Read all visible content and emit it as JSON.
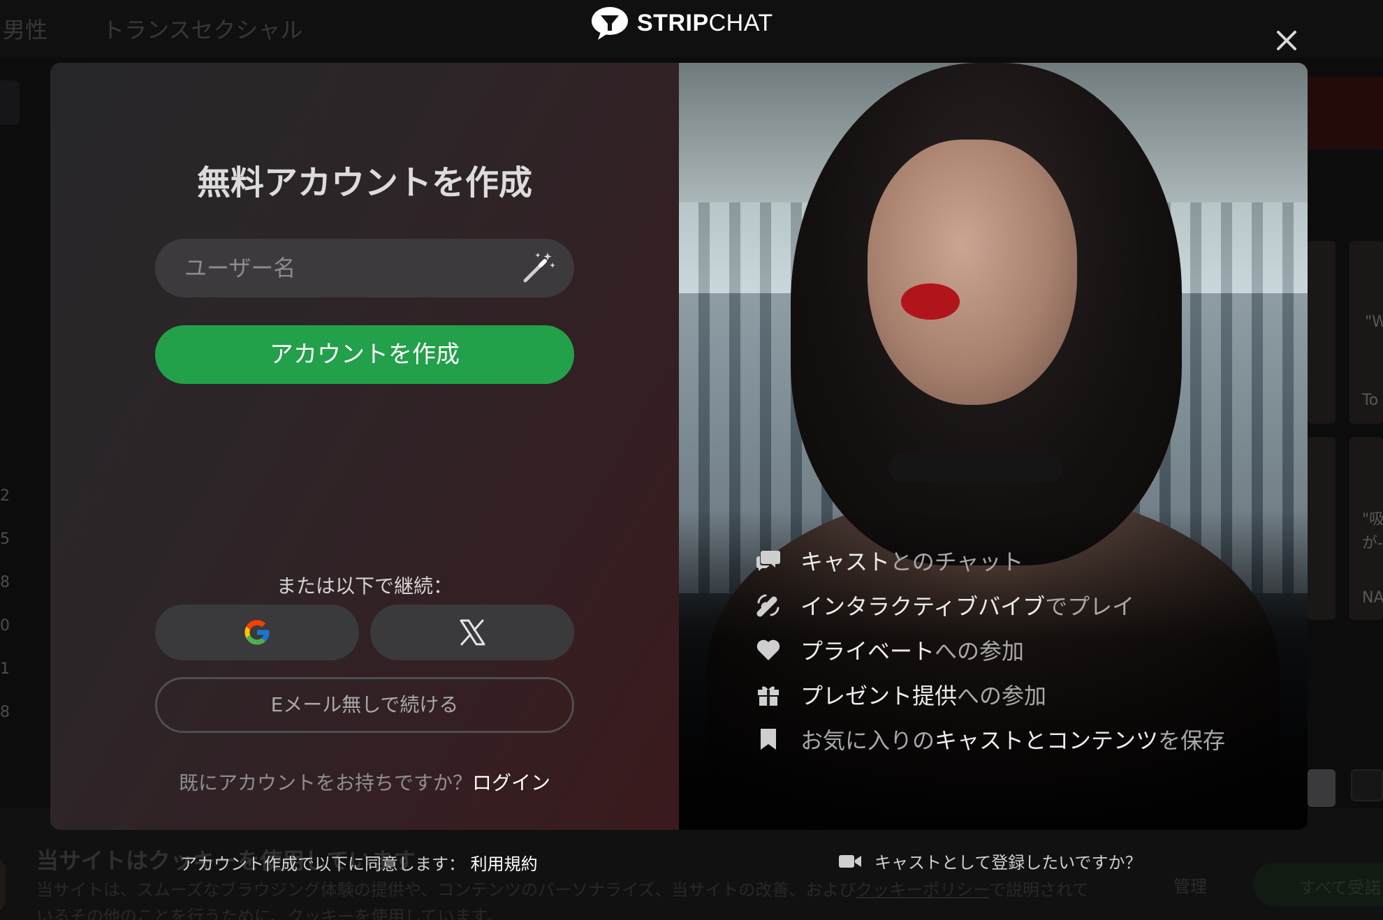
{
  "background": {
    "nav": [
      "男性",
      "トランスセクシャル"
    ],
    "side_numbers": [
      "2",
      "5",
      "8",
      "0",
      "1",
      "8"
    ],
    "tile_labels": [
      "\"W",
      "To",
      "\"吸",
      "が-",
      "NA"
    ],
    "cookie": {
      "title": "当サイトはクッキーを使用しています",
      "text_before_link": "当サイトは、スムーズなブラウジング体験の提供や、コンテンツのパーソナライズ、当サイトの改善、および",
      "link": "クッキーポリシー",
      "text_after_link": "で説明されているその他のことを行うために、クッキーを使用しています。",
      "manage": "管理",
      "accept": "すべて受諾"
    }
  },
  "brand": {
    "name_bold": "STRIP",
    "name_regular": "CHAT"
  },
  "signup": {
    "title": "無料アカウントを作成",
    "username_placeholder": "ユーザー名",
    "create_button": "アカウントを作成",
    "or_continue": "または以下で継続：",
    "no_email_button": "Eメール無しで続ける",
    "have_account": "既にアカウントをお持ちですか？",
    "login_link": "ログイン"
  },
  "features": [
    {
      "icon": "chat-bubbles-icon",
      "bright": "キャスト",
      "dim": "とのチャット"
    },
    {
      "icon": "vibe-icon",
      "bright": "インタラクティブバイブ",
      "dim": "でプレイ"
    },
    {
      "icon": "heart-icon",
      "bright": "プライベート",
      "dim": "への参加"
    },
    {
      "icon": "gift-icon",
      "bright": "プレゼント提供",
      "dim": "への参加"
    },
    {
      "icon": "bookmark-icon",
      "prefix": "お気に入りの",
      "bright": "キャストとコンテンツ",
      "dim": "を保存"
    }
  ],
  "footer": {
    "agree_text": "アカウント作成で以下に同意します：",
    "terms_link": "利用規約",
    "become_model": "キャストとして登録したいですか？"
  },
  "colors": {
    "accent_green": "#22a04a",
    "lips_red": "#b2141c"
  }
}
